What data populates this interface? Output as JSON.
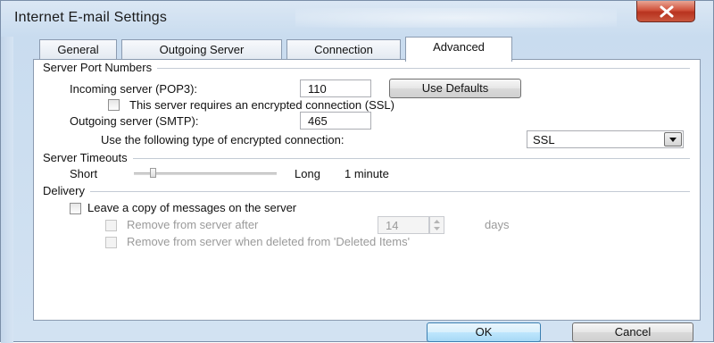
{
  "window": {
    "title": "Internet E-mail Settings"
  },
  "tabs": [
    {
      "label": "General"
    },
    {
      "label": "Outgoing Server"
    },
    {
      "label": "Connection"
    },
    {
      "label": "Advanced"
    }
  ],
  "server_ports": {
    "group_label": "Server Port Numbers",
    "incoming_label": "Incoming server (POP3):",
    "incoming_value": "110",
    "use_defaults_label": "Use Defaults",
    "ssl_checkbox_label": "This server requires an encrypted connection (SSL)",
    "outgoing_label": "Outgoing server (SMTP):",
    "outgoing_value": "465",
    "encryption_label": "Use the following type of encrypted connection:",
    "encryption_value": "SSL"
  },
  "server_timeouts": {
    "group_label": "Server Timeouts",
    "short_label": "Short",
    "long_label": "Long",
    "value_label": "1 minute"
  },
  "delivery": {
    "group_label": "Delivery",
    "leave_copy_label": "Leave a copy of messages on the server",
    "remove_after_label": "Remove from server after",
    "remove_after_value": "14",
    "days_label": "days",
    "remove_deleted_label": "Remove from server when deleted from 'Deleted Items'"
  },
  "footer": {
    "ok_label": "OK",
    "cancel_label": "Cancel"
  },
  "colors": {
    "frame": "#c9dcef",
    "close_button": "#c9563d",
    "ok_accent": "#3c7fb1"
  }
}
